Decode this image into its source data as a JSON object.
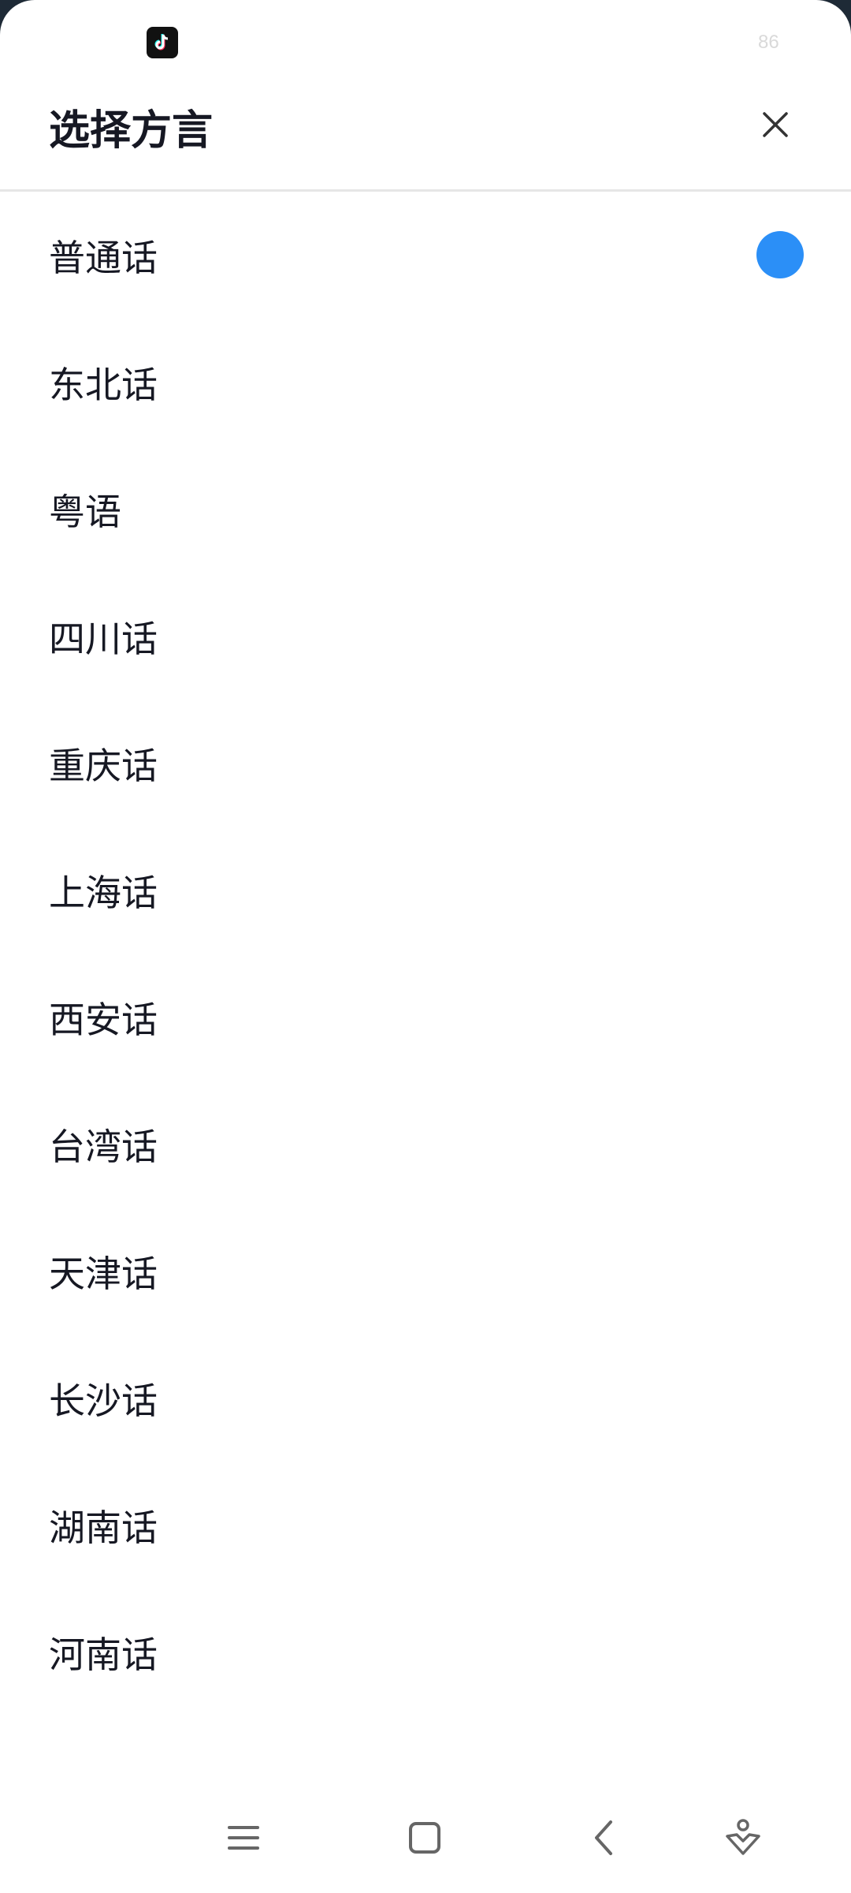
{
  "status_bar": {
    "app_icon": "tiktok-icon",
    "battery": "86"
  },
  "header": {
    "title": "选择方言",
    "close_icon": "close-icon"
  },
  "dialects": [
    {
      "label": "普通话",
      "selected": true
    },
    {
      "label": "东北话",
      "selected": false
    },
    {
      "label": "粤语",
      "selected": false
    },
    {
      "label": "四川话",
      "selected": false
    },
    {
      "label": "重庆话",
      "selected": false
    },
    {
      "label": "上海话",
      "selected": false
    },
    {
      "label": "西安话",
      "selected": false
    },
    {
      "label": "台湾话",
      "selected": false
    },
    {
      "label": "天津话",
      "selected": false
    },
    {
      "label": "长沙话",
      "selected": false
    },
    {
      "label": "湖南话",
      "selected": false
    },
    {
      "label": "河南话",
      "selected": false
    }
  ],
  "colors": {
    "accent": "#2b8ff7",
    "text": "#161823",
    "divider": "#e6e6e6"
  },
  "nav_bar": {
    "items": [
      "menu-icon",
      "home-icon",
      "back-icon",
      "assistant-icon"
    ]
  }
}
